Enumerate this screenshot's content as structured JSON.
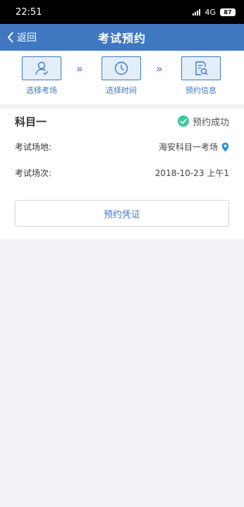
{
  "status_bar": {
    "time": "22:51",
    "network": "4G",
    "battery": "87"
  },
  "header": {
    "back_label": "返回",
    "title": "考试预约"
  },
  "steps": [
    {
      "label": "选择考场",
      "icon": "person-check-icon"
    },
    {
      "label": "选择时间",
      "icon": "clock-icon"
    },
    {
      "label": "预约信息",
      "icon": "document-search-icon"
    }
  ],
  "result": {
    "subject": "科目一",
    "status": "预约成功",
    "status_color": "#3fc8a0",
    "venue_label": "考试场地:",
    "venue_value": "海安科目一考场",
    "session_label": "考试场次:",
    "session_value": "2018-10-23 上午1",
    "voucher_button": "预约凭证"
  },
  "colors": {
    "primary": "#3f78c1",
    "step_bg": "#e3eefb"
  }
}
